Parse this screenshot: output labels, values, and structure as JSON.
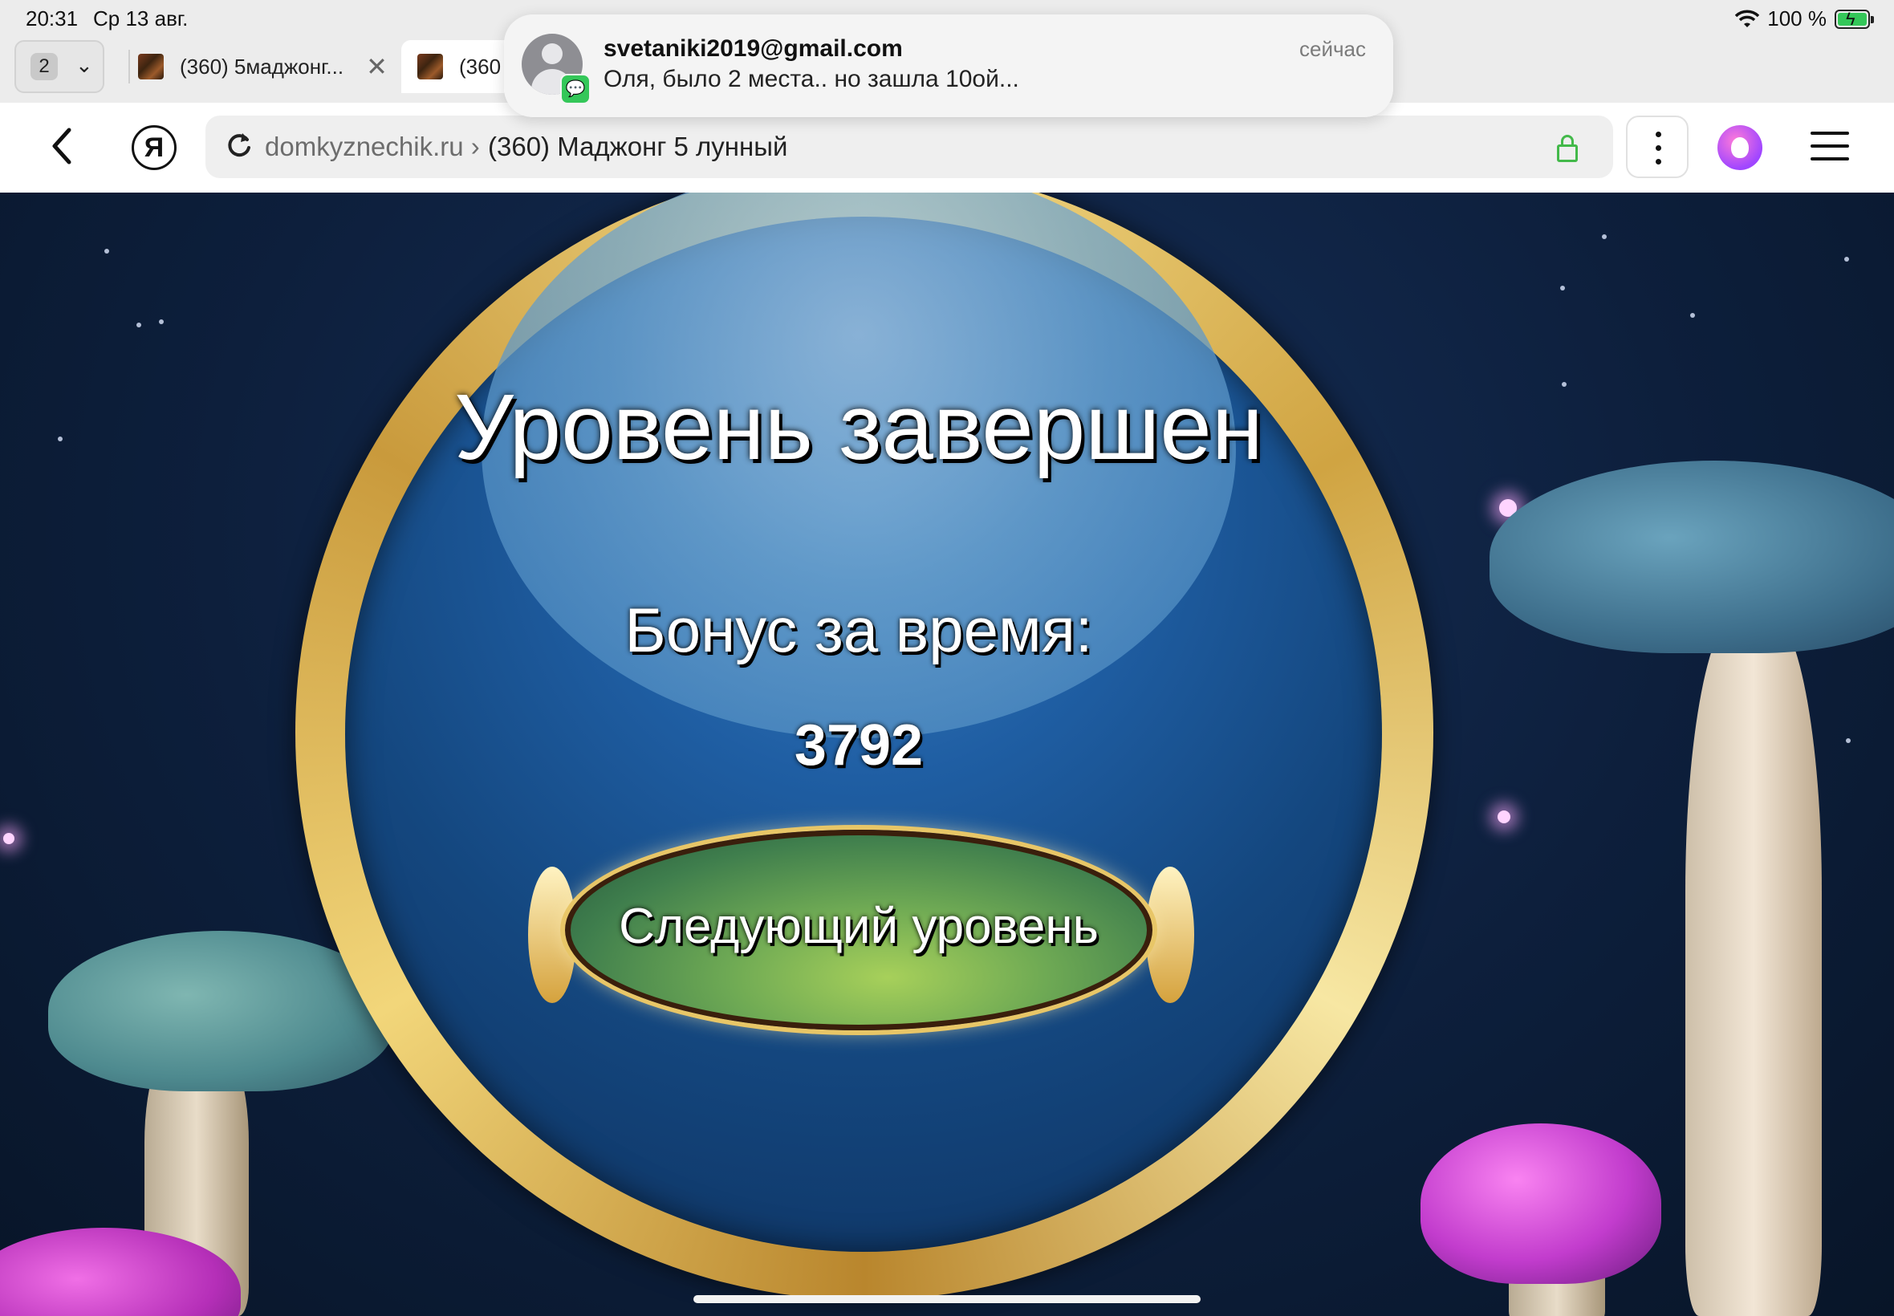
{
  "status": {
    "time": "20:31",
    "date": "Ср 13 авг.",
    "battery": "100 %"
  },
  "tabs": {
    "count": "2",
    "items": [
      {
        "title": "(360) 5маджонг..."
      },
      {
        "title": "(360"
      }
    ]
  },
  "notification": {
    "sender": "svetaniki2019@gmail.com",
    "preview": "Оля, было 2 места.. но зашла 10ой...",
    "time": "сейчас"
  },
  "addressbar": {
    "domain": "domkyznechik.ru ›",
    "title": "(360) Маджонг 5 лунный"
  },
  "game": {
    "title": "Уровень завершен",
    "bonus_label": "Бонус за время:",
    "bonus_value": "3792",
    "next_button": "Следующий уровень"
  }
}
